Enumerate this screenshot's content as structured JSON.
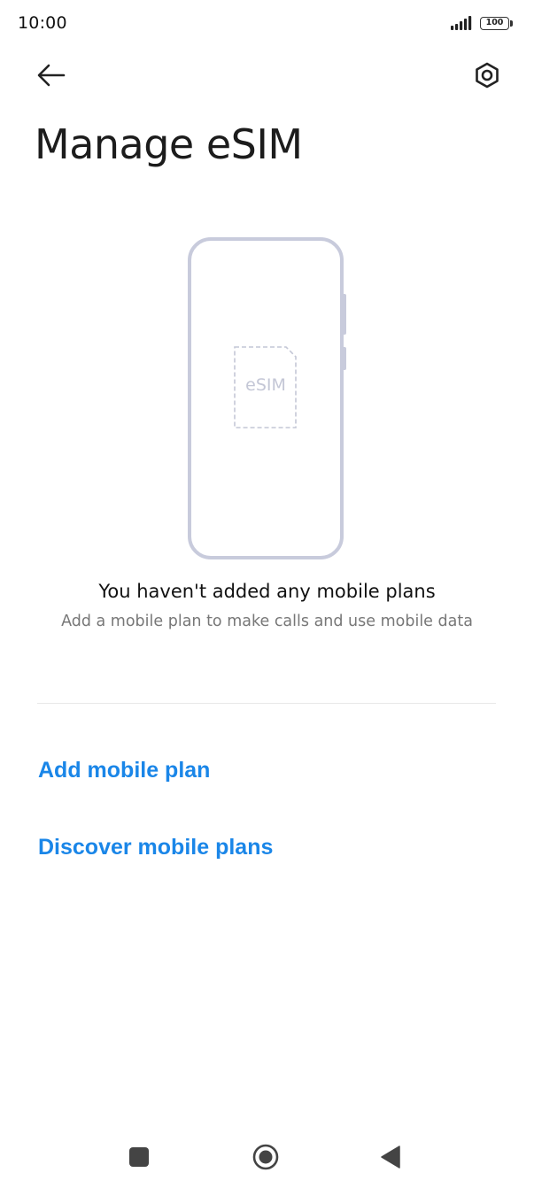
{
  "status_bar": {
    "time": "10:00",
    "battery_level": "100",
    "signal_icon": "signal-bars-icon"
  },
  "header": {
    "back_icon": "arrow-left-icon",
    "settings_icon": "gear-icon",
    "title": "Manage eSIM"
  },
  "illustration": {
    "esim_label": "eSIM",
    "phone_color": "#c8cbdc",
    "esim_color": "#c4c7d6"
  },
  "empty_state": {
    "title": "You haven't added any mobile plans",
    "subtitle": "Add a mobile plan to make calls and use mobile data"
  },
  "actions": {
    "add_plan": "Add mobile plan",
    "discover_plans": "Discover mobile plans",
    "accent_color": "#1a86e8"
  },
  "nav_bar": {
    "recent_icon": "square-icon",
    "home_icon": "circle-home-icon",
    "back_icon": "triangle-back-icon"
  }
}
